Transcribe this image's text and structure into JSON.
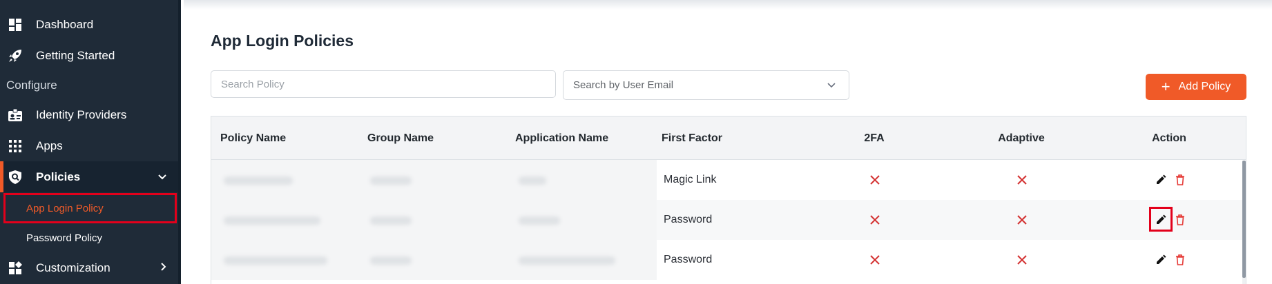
{
  "sidebar": {
    "items": [
      {
        "label": "Dashboard",
        "icon": "dashboard-icon"
      },
      {
        "label": "Getting Started",
        "icon": "rocket-icon"
      },
      {
        "label": "Identity Providers",
        "icon": "id-badge-icon"
      },
      {
        "label": "Apps",
        "icon": "apps-grid-icon"
      },
      {
        "label": "Policies",
        "icon": "shield-search-icon"
      },
      {
        "label": "Customization",
        "icon": "widgets-icon"
      }
    ],
    "section": "Configure",
    "subitems": [
      {
        "label": "App Login Policy"
      },
      {
        "label": "Password Policy"
      }
    ]
  },
  "main": {
    "title": "App Login Policies",
    "search_placeholder": "Search Policy",
    "email_select": "Search by User Email",
    "add_button": "Add Policy"
  },
  "table": {
    "headers": [
      "Policy Name",
      "Group Name",
      "Application Name",
      "First Factor",
      "2FA",
      "Adaptive",
      "Action"
    ],
    "rows": [
      {
        "first_factor": "Magic Link",
        "two_fa": "disabled",
        "adaptive": "disabled"
      },
      {
        "first_factor": "Password",
        "two_fa": "disabled",
        "adaptive": "disabled"
      },
      {
        "first_factor": "Password",
        "two_fa": "disabled",
        "adaptive": "disabled"
      }
    ]
  },
  "colors": {
    "accent": "#f05a28",
    "sidebar_bg": "#1f2b38",
    "highlight": "#e3001b",
    "x_red": "#d32f2f"
  }
}
